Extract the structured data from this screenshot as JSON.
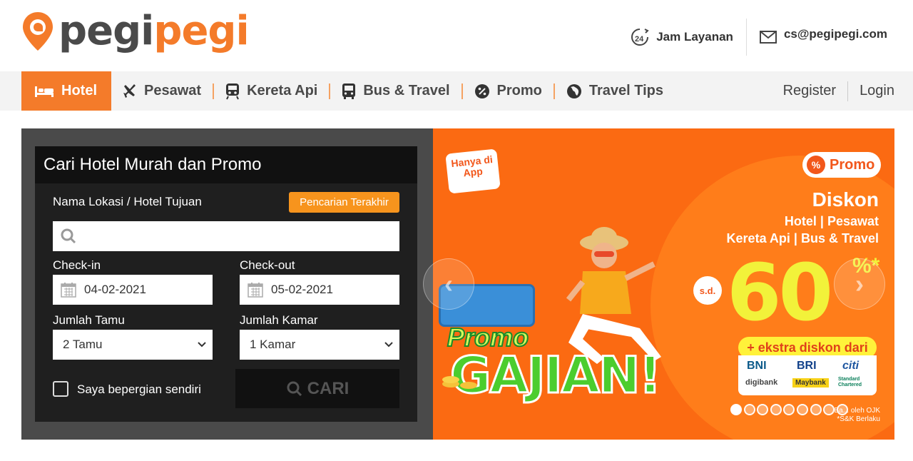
{
  "brand": {
    "name_part1": "pegi",
    "name_part2": "pegi",
    "accent": "#f47b2a"
  },
  "contact": {
    "service_label": "Jam Layanan",
    "service_icon": "clock-24-icon",
    "email": "cs@pegipegi.com",
    "email_icon": "mail-icon"
  },
  "nav": {
    "items": [
      {
        "label": "Hotel",
        "icon": "bed-icon",
        "active": true
      },
      {
        "label": "Pesawat",
        "icon": "plane-icon"
      },
      {
        "label": "Kereta Api",
        "icon": "train-icon"
      },
      {
        "label": "Bus & Travel",
        "icon": "bus-icon"
      },
      {
        "label": "Promo",
        "icon": "percent-badge-icon"
      },
      {
        "label": "Travel Tips",
        "icon": "globe-icon"
      }
    ],
    "register": "Register",
    "login": "Login"
  },
  "search": {
    "title": "Cari Hotel Murah dan Promo",
    "location_label": "Nama Lokasi / Hotel Tujuan",
    "recent_button": "Pencarian Terakhir",
    "location_value": "",
    "checkin_label": "Check-in",
    "checkin_value": "04-02-2021",
    "checkout_label": "Check-out",
    "checkout_value": "05-02-2021",
    "guests_label": "Jumlah Tamu",
    "guests_value": "2 Tamu",
    "rooms_label": "Jumlah Kamar",
    "rooms_value": "1 Kamar",
    "solo_label": "Saya bepergian sendiri",
    "solo_checked": false,
    "submit_label": "CARI"
  },
  "banner": {
    "hanya_di_app": "Hanya di App",
    "promo_badge": "Promo",
    "promo_badge_symbol": "%",
    "diskon": "Diskon",
    "services_line1": "Hotel | Pesawat",
    "services_line2": "Kereta Api | Bus & Travel",
    "sd": "s.d.",
    "percent": "60",
    "percent_sign": "%*",
    "ekstra": "+ ekstra diskon dari",
    "banks": [
      "BNI",
      "BRI",
      "citi",
      "digibank",
      "Maybank",
      "Standard Chartered"
    ],
    "promo_word": "Promo",
    "gajian_word": "GAJIAN!",
    "footnote_line1": "Ba... oleh OJK",
    "footnote_line2": "*S&K Berlaku",
    "dot_count": 9,
    "active_dot": 0
  }
}
